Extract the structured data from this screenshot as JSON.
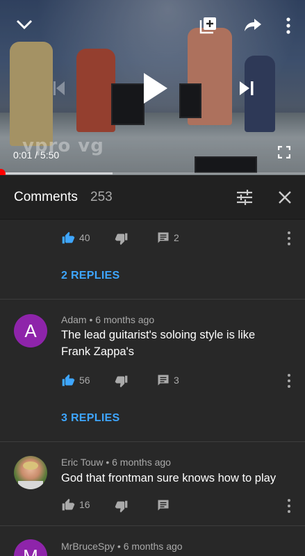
{
  "video": {
    "watermark": "vpro vg",
    "current_time": "0:01",
    "duration": "5:50",
    "time_separator": " / ",
    "progress_fraction": 0.003,
    "buffered_fraction": 0.37
  },
  "comments_panel": {
    "title": "Comments",
    "count": "253"
  },
  "comments": [
    {
      "likes": "40",
      "replies_count": "2",
      "replies_label": "2 REPLIES",
      "liked": true
    },
    {
      "avatar_letter": "A",
      "avatar_color": "#8e24aa",
      "author": "Adam",
      "time": "6 months ago",
      "text_line1": "The lead guitarist's soloing style is like",
      "text_line2": "Frank Zappa's",
      "likes": "56",
      "replies_count": "3",
      "replies_label": "3 REPLIES",
      "liked": true
    },
    {
      "author": "Eric Touw",
      "time": "6 months ago",
      "text": "God that frontman sure knows how to play",
      "likes": "16",
      "liked": false
    },
    {
      "avatar_letter": "M",
      "avatar_color": "#8e24aa",
      "author": "MrBruceSpy",
      "time": "6 months ago"
    }
  ],
  "meta_separator": " • ",
  "colors": {
    "accent_blue": "#3ea6ff",
    "progress_red": "#ff0000",
    "panel_bg": "#282828",
    "header_bg": "#212121"
  }
}
